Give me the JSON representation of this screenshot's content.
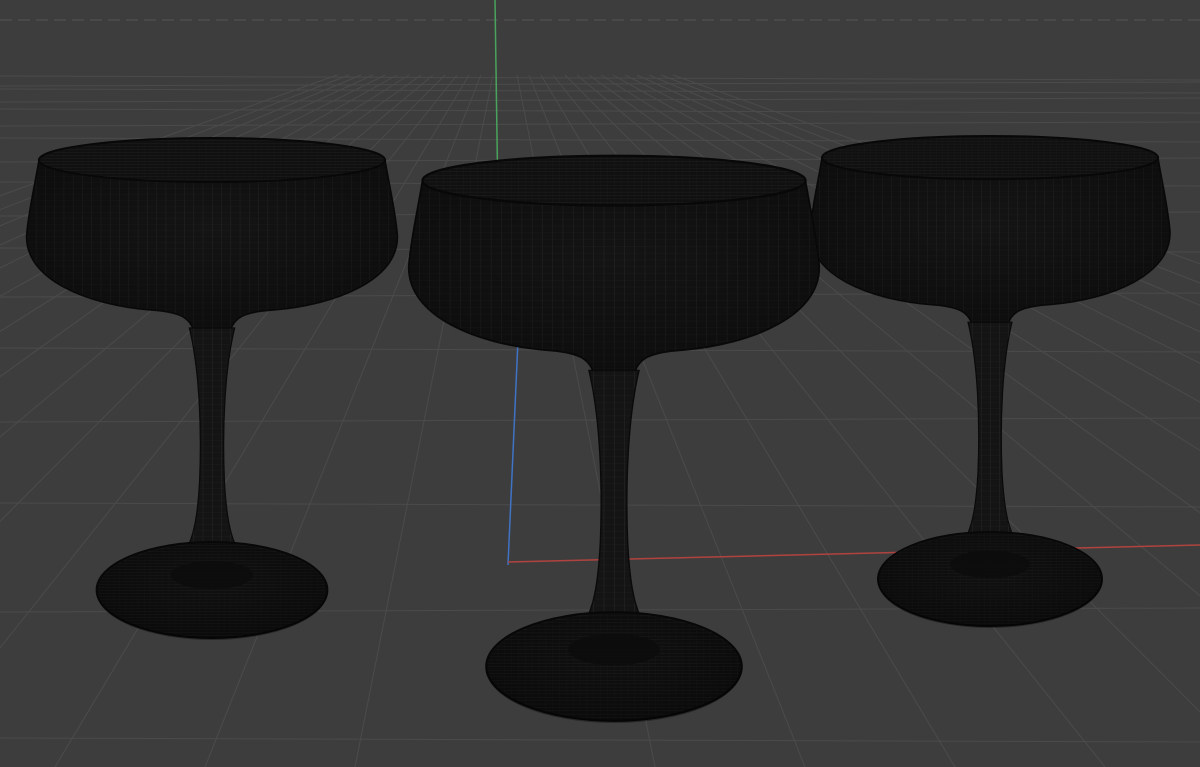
{
  "viewport": {
    "view": "perspective",
    "display_mode": "wireframe-on-shaded",
    "background_color": "#3d3d3d",
    "grid_color": "#4b4b4b",
    "axis_colors": {
      "x": "#b0433f",
      "y": "#4aa35c",
      "z": "#3f73c4"
    }
  },
  "scene": {
    "objects": [
      {
        "name": "coupe-glass-left",
        "type": "coupe-glass",
        "wire_color": "#0f0f0f"
      },
      {
        "name": "coupe-glass-center",
        "type": "coupe-glass",
        "wire_color": "#0f0f0f"
      },
      {
        "name": "coupe-glass-right",
        "type": "coupe-glass",
        "wire_color": "#0f0f0f"
      }
    ]
  }
}
